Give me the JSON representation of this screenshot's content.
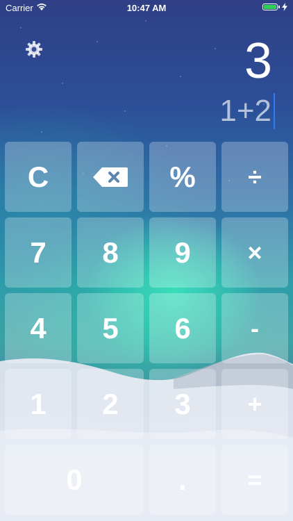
{
  "status_bar": {
    "carrier": "Carrier",
    "time": "10:47 AM",
    "battery_level": 1.0,
    "battery_color": "#2ed158",
    "icons": [
      "wifi-icon",
      "battery-icon",
      "charging-bolt-icon"
    ]
  },
  "display": {
    "settings_icon": "gear-icon",
    "result": "3",
    "expression": "1+2",
    "cursor_color": "#2f7df6"
  },
  "keypad": {
    "row1": [
      "C",
      "backspace-icon",
      "%",
      "÷"
    ],
    "row2": [
      "7",
      "8",
      "9",
      "×"
    ],
    "row3": [
      "4",
      "5",
      "6",
      "-"
    ],
    "row4": [
      "1",
      "2",
      "3",
      "+"
    ],
    "row5": [
      "0",
      ".",
      "="
    ],
    "key_clear": "C",
    "key_backspace_icon": "backspace-icon",
    "key_percent": "%",
    "key_divide": "÷",
    "key_7": "7",
    "key_8": "8",
    "key_9": "9",
    "key_multiply": "×",
    "key_4": "4",
    "key_5": "5",
    "key_6": "6",
    "key_minus": "-",
    "key_1": "1",
    "key_2": "2",
    "key_3": "3",
    "key_plus": "+",
    "key_0": "0",
    "key_decimal": ".",
    "key_equals": "="
  }
}
